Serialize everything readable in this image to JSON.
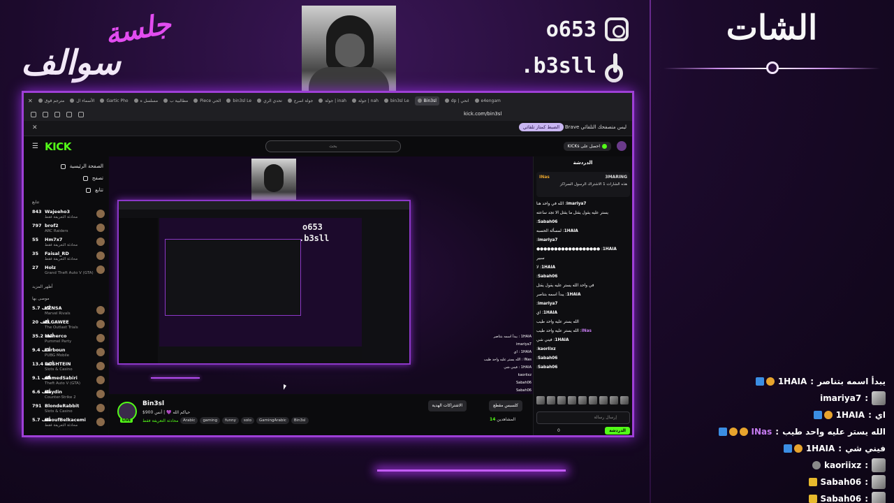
{
  "overlay": {
    "brand_line1": "جلسة",
    "brand_line2": "سوالف",
    "instagram": "o653",
    "tiktok": ".b3sll",
    "chat_title": "الشات",
    "accent": "#9e3fd6"
  },
  "side_chat": [
    {
      "badges": [
        "b-blue",
        "b-gold"
      ],
      "name": "1HAIA",
      "msg": "يبدأ اسمه بتناصر",
      "purple": false,
      "sticker": false
    },
    {
      "badges": [],
      "name": "imariya7",
      "msg": "",
      "purple": false,
      "sticker": true
    },
    {
      "badges": [
        "b-blue",
        "b-gold"
      ],
      "name": "1HAIA",
      "msg": "اي",
      "purple": false,
      "sticker": false
    },
    {
      "badges": [
        "b-blue",
        "b-gold",
        "b-gold"
      ],
      "name": "INas",
      "msg": "الله يستر عليه واحد طيب",
      "purple": true,
      "sticker": false
    },
    {
      "badges": [
        "b-blue",
        "b-gold"
      ],
      "name": "1HAIA",
      "msg": "فيني شي",
      "purple": false,
      "sticker": false
    },
    {
      "badges": [
        "b-gray"
      ],
      "name": "kaoriixz",
      "msg": "",
      "purple": false,
      "sticker": true
    },
    {
      "badges": [
        "b-mic"
      ],
      "name": "Sabah06",
      "msg": "",
      "purple": false,
      "sticker": true
    },
    {
      "badges": [
        "b-mic"
      ],
      "name": "Sabah06",
      "msg": "",
      "purple": false,
      "sticker": true
    }
  ],
  "browser": {
    "tabs": [
      "مترجم قوق",
      "الأسماء ال",
      "Gartic Pho",
      "مسلسل ه",
      "مطالبية ب",
      "Piece الحي",
      "bin3sl Le",
      "تحدي الري",
      "جولة اسرع",
      "جولة | inah",
      "جولة | nah",
      "bin3sl Le",
      "Bin3sl",
      "dp | انحي",
      "e4engam"
    ],
    "active_tab": "Bin3sl",
    "url": "kick.com/bin3sl",
    "infobar_msg": "ليس متصفحك التلقائي Brave",
    "infobar_button": "الضبط كمتاز تلقائي"
  },
  "kick": {
    "logo": "KICK",
    "search_placeholder": "بحث",
    "get_kicks": "احصل على KICKs",
    "nav": [
      "الصفحة الرئيسية",
      "تصفح",
      "تتابع"
    ],
    "following_header": "تتابع",
    "channels": [
      {
        "viewers": "843",
        "name": "Wajeeho3",
        "sub": "محادثة التعريفة فقط"
      },
      {
        "viewers": "797",
        "name": "brof2",
        "sub": "ARC Raiders"
      },
      {
        "viewers": "55",
        "name": "Hm7x7",
        "sub": "محادثة التعريفة فقط"
      },
      {
        "viewers": "35",
        "name": "Faisal_RD",
        "sub": "محادثة التعريفة فقط"
      },
      {
        "viewers": "27",
        "name": "Holz",
        "sub": "Grand Theft Auto V (GTA)"
      }
    ],
    "more_label": "أظهر المزيد",
    "recommended_header": "موصى بها",
    "recommended": [
      {
        "viewers": "5.7 ألف",
        "name": "YZNSA",
        "sub": "Marvel Rivals"
      },
      {
        "viewers": "20 ألف",
        "name": "ELGAWEE",
        "sub": "The Outlast Trials"
      },
      {
        "viewers": "35.2 ألف",
        "name": "Maherco",
        "sub": "Pummel Party"
      },
      {
        "viewers": "9.4 ألف",
        "name": "Tarboun",
        "sub": "PUBG Mobile"
      },
      {
        "viewers": "13.4 ألف",
        "name": "ROSHTEIN",
        "sub": "Slots & Casino"
      },
      {
        "viewers": "9.1 ألف",
        "name": "AhmedSabiri",
        "sub": "Theft Auto V (GTA)"
      },
      {
        "viewers": "6.6 ألف",
        "name": "Raydin",
        "sub": "Counter-Strike 2"
      },
      {
        "viewers": "791",
        "name": "BlondeRabbit",
        "sub": "Slots & Casino"
      },
      {
        "viewers": "5.7 ألف",
        "name": "RaoufBelkacemi",
        "sub": "محادثة التعريفة فقط"
      }
    ],
    "stream": {
      "name": "Bin3sl",
      "live": "LIVE",
      "title": "حياكم الله 💜 | أنس 900$",
      "category": "محادثة التعريفة فقط",
      "tags": [
        "Arabic",
        "gaming",
        "funny",
        "solo",
        "GamingArabic",
        "Bin3sl"
      ],
      "subscribe_btn": "الاشتراكات الهدية",
      "clip_btn": "كلسبس مقطع",
      "viewers_label": "المشاهدين",
      "viewers": "14"
    },
    "chat": {
      "header": "الدردشة",
      "pinned_user": "INas",
      "pinned_user2": "3MARING",
      "pinned_text": "هذه الشارات 1 الاشتراك الرسول السراكز",
      "messages": [
        {
          "u": "imariya7",
          "t": "الله في واحد هنا",
          "p": false
        },
        {
          "u": "",
          "t": "يستر عليه يقول يقتل ما يقتل الا تجد ساعته",
          "p": false
        },
        {
          "u": "Sabah06",
          "t": "",
          "p": false
        },
        {
          "u": "1HAIA",
          "t": "لمسألة الحسبه",
          "p": false
        },
        {
          "u": "imariya7",
          "t": "",
          "p": false
        },
        {
          "u": "1HAIA",
          "t": "●●●●●●●●●●●●●●●●●●",
          "p": false
        },
        {
          "u": "",
          "t": "سبير",
          "p": false
        },
        {
          "u": "1HAIA",
          "t": "لا",
          "p": false
        },
        {
          "u": "Sabah06",
          "t": "",
          "p": false
        },
        {
          "u": "",
          "t": "في واحد الله يستر عليه يقول يقتل",
          "p": false
        },
        {
          "u": "1HAIA",
          "t": "يبدأ اسمه بتناصر",
          "p": false
        },
        {
          "u": "imariya7",
          "t": "",
          "p": false
        },
        {
          "u": "1HAIA",
          "t": "اي",
          "p": false
        },
        {
          "u": "",
          "t": "الله يستر عليه واحد طيب",
          "p": false
        },
        {
          "u": "INas",
          "t": "الله يستر عليه واحد طيب",
          "p": true
        },
        {
          "u": "1HAIA",
          "t": "فيني شي",
          "p": false
        },
        {
          "u": "kaoriixz",
          "t": "",
          "p": false
        },
        {
          "u": "Sabah06",
          "t": "",
          "p": false
        },
        {
          "u": "Sabah06",
          "t": "",
          "p": false
        }
      ],
      "input_placeholder": "إرسال رسالة",
      "send": "الدردشة",
      "count": "0"
    }
  }
}
